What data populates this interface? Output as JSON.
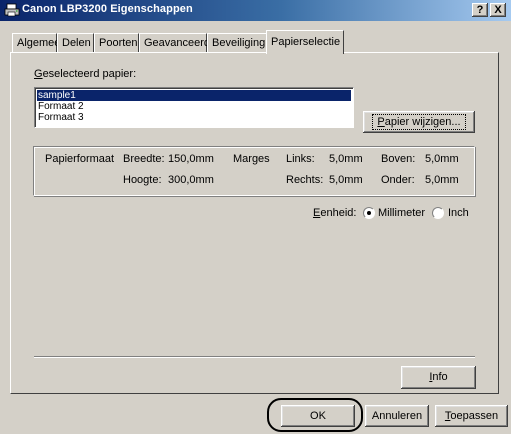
{
  "window": {
    "title": "Canon LBP3200 Eigenschappen"
  },
  "caption_buttons": {
    "help": "?",
    "close": "X"
  },
  "tabs": [
    {
      "label": "Algemeen"
    },
    {
      "label": "Delen"
    },
    {
      "label": "Poorten"
    },
    {
      "label": "Geavanceerd"
    },
    {
      "label": "Beveiliging"
    },
    {
      "label": "Papierselectie",
      "active": true
    }
  ],
  "selected_paper": {
    "label": "Geselecteerd papier:",
    "items": [
      "sample1",
      "Formaat 2",
      "Formaat 3"
    ],
    "selected_index": 0
  },
  "change_paper_button": "Papier wijzigen...",
  "paper_info": {
    "paper_format_label": "Papierformaat",
    "width_label": "Breedte:",
    "width_value": "150,0mm",
    "height_label": "Hoogte:",
    "height_value": "300,0mm",
    "margins_label": "Marges",
    "left_label": "Links:",
    "left_value": "5,0mm",
    "right_label": "Rechts:",
    "right_value": "5,0mm",
    "top_label": "Boven:",
    "top_value": "5,0mm",
    "bottom_label": "Onder:",
    "bottom_value": "5,0mm"
  },
  "unit": {
    "label": "Eenheid:",
    "options": [
      "Millimeter",
      "Inch"
    ],
    "selected": "Millimeter"
  },
  "info_button": "Info",
  "footer": {
    "ok": "OK",
    "cancel": "Annuleren",
    "apply": "Toepassen"
  }
}
